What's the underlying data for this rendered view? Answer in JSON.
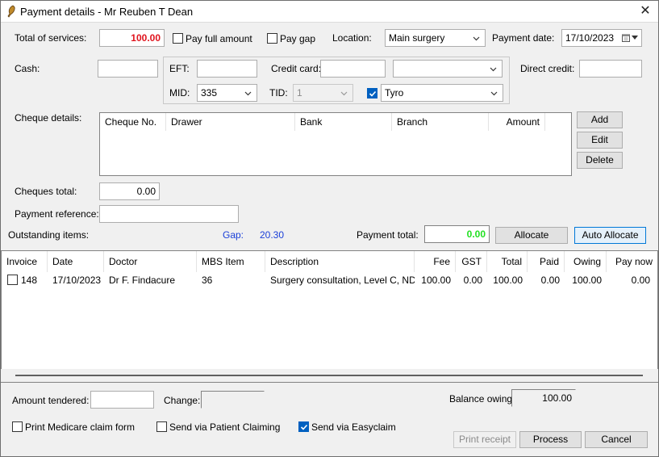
{
  "window": {
    "title": "Payment details - Mr Reuben T Dean",
    "close_symbol": "✕"
  },
  "services": {
    "total_label": "Total of services:",
    "total_value": "100.00",
    "pay_full_label": "Pay full amount",
    "pay_gap_label": "Pay gap",
    "location_label": "Location:",
    "location_value": "Main surgery",
    "payment_date_label": "Payment date:",
    "payment_date_value": "17/10/2023"
  },
  "payment": {
    "cash_label": "Cash:",
    "cash_value": "",
    "eft_label": "EFT:",
    "eft_value": "",
    "credit_card_label": "Credit card:",
    "credit_card_value": "",
    "credit_card_type": "",
    "direct_credit_label": "Direct credit:",
    "direct_credit_value": "",
    "mid_label": "MID:",
    "mid_value": "335",
    "tid_label": "TID:",
    "tid_value": "1",
    "terminal_value": "Tyro"
  },
  "cheques": {
    "label": "Cheque details:",
    "columns": [
      "Cheque No.",
      "Drawer",
      "Bank",
      "Branch",
      "Amount"
    ],
    "add_label": "Add",
    "edit_label": "Edit",
    "delete_label": "Delete",
    "total_label": "Cheques total:",
    "total_value": "0.00"
  },
  "reference": {
    "label": "Payment reference:",
    "value": ""
  },
  "outstanding": {
    "label": "Outstanding items:",
    "gap_label": "Gap:",
    "gap_value": "20.30",
    "payment_total_label": "Payment total:",
    "payment_total_value": "0.00",
    "allocate_label": "Allocate",
    "auto_allocate_label": "Auto Allocate"
  },
  "items": {
    "columns": [
      "Invoice",
      "Date",
      "Doctor",
      "MBS Item",
      "Description",
      "Fee",
      "GST",
      "Total",
      "Paid",
      "Owing",
      "Pay now"
    ],
    "rows": [
      {
        "invoice": "148",
        "date": "17/10/2023",
        "doctor": "Dr F. Findacure",
        "mbs": "36",
        "description": "Surgery consultation, Level C, ND...",
        "fee": "100.00",
        "gst": "0.00",
        "total": "100.00",
        "paid": "0.00",
        "owing": "100.00",
        "pay_now": "0.00"
      }
    ]
  },
  "footer": {
    "amount_tendered_label": "Amount tendered:",
    "amount_tendered_value": "",
    "change_label": "Change:",
    "change_value": "",
    "balance_label": "Balance owing:",
    "balance_value": "100.00",
    "print_medicare_label": "Print Medicare claim form",
    "patient_claiming_label": "Send via Patient Claiming",
    "easyclaim_label": "Send via Easyclaim",
    "print_receipt_label": "Print receipt",
    "process_label": "Process",
    "cancel_label": "Cancel"
  },
  "colors": {
    "total_red": "#e0141e",
    "gap_blue": "#1a3fd8",
    "payment_total_green": "#22e022",
    "accent": "#0078d7"
  },
  "icons": {
    "app": "app-feather-icon",
    "calendar": "calendar-icon",
    "chevron": "chevron-down-icon",
    "check": "check-icon"
  }
}
